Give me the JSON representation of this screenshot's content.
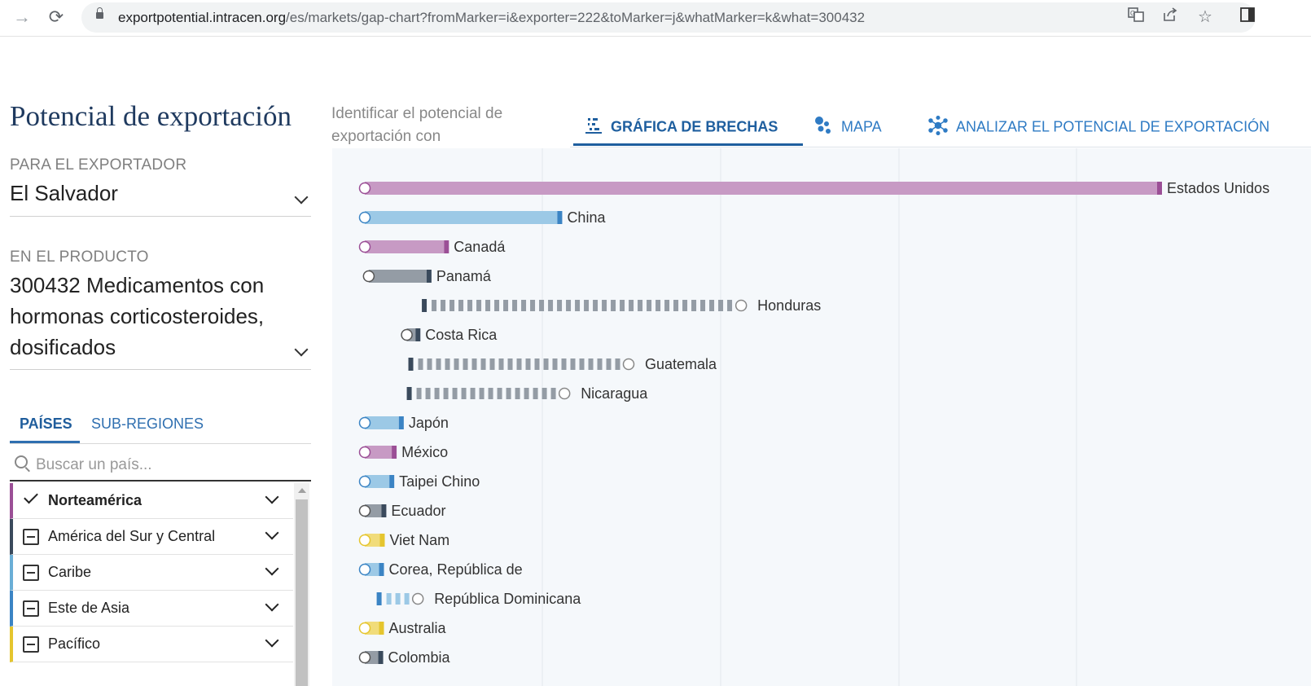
{
  "browser": {
    "url_host": "exportpotential.intracen.org",
    "url_path": "/es/markets/gap-chart?fromMarker=i&exporter=222&toMarker=j&whatMarker=k&what=300432"
  },
  "app": {
    "title": "Potencial de exportación"
  },
  "exporter": {
    "label": "PARA EL EXPORTADOR",
    "value": "El Salvador"
  },
  "product": {
    "label": "EN EL PRODUCTO",
    "lines": [
      "300432 Medicamentos con",
      "hormonas corticosteroides,",
      "dosificados"
    ]
  },
  "left_tabs": {
    "countries": "PAÍSES",
    "subregions": "SUB-REGIONES"
  },
  "search": {
    "placeholder": "Buscar un país..."
  },
  "regions": [
    {
      "label": "Norteamérica",
      "color": "#9b4f96",
      "selected": true
    },
    {
      "label": "América del Sur y Central",
      "color": "#3a4a5c",
      "selected": false
    },
    {
      "label": "Caribe",
      "color": "#6aaed6",
      "selected": false
    },
    {
      "label": "Este de Asia",
      "color": "#3b84c4",
      "selected": false
    },
    {
      "label": "Pacífico",
      "color": "#e5c52e",
      "selected": false
    }
  ],
  "identify_text": "Identificar el potencial de exportación con",
  "main_tabs": {
    "gap_chart": "GRÁFICA DE BRECHAS",
    "map": "MAPA",
    "analyze": "ANALIZAR EL POTENCIAL DE EXPORTACIÓN"
  },
  "colors": {
    "north_america": "#c79ac4",
    "north_america_dark": "#9b4f96",
    "east_asia": "#9cc9e6",
    "east_asia_dark": "#3b84c4",
    "central_south": "#949ca5",
    "central_south_dark": "#3a4a5c",
    "pacific": "#f1dc7a",
    "pacific_dark": "#e5c52e",
    "accent": "#2f7bc4"
  },
  "chart_data": {
    "type": "gap-chart",
    "rows": [
      {
        "country": "Estados Unidos",
        "potential": 0.0,
        "actual": 1.0,
        "direction": "under",
        "group": "north_america"
      },
      {
        "country": "China",
        "potential": 0.0,
        "actual": 0.243,
        "direction": "under",
        "group": "east_asia"
      },
      {
        "country": "Canadá",
        "potential": 0.0,
        "actual": 0.1,
        "direction": "under",
        "group": "north_america"
      },
      {
        "country": "Panamá",
        "potential": 0.005,
        "actual": 0.078,
        "direction": "under",
        "group": "central_south"
      },
      {
        "country": "Honduras",
        "potential": 0.475,
        "actual": 0.072,
        "direction": "over",
        "group": "central_south"
      },
      {
        "country": "Costa Rica",
        "potential": 0.053,
        "actual": 0.064,
        "direction": "under",
        "group": "central_south"
      },
      {
        "country": "Guatemala",
        "potential": 0.333,
        "actual": 0.055,
        "direction": "over",
        "group": "central_south"
      },
      {
        "country": "Nicaragua",
        "potential": 0.252,
        "actual": 0.053,
        "direction": "over",
        "group": "central_south"
      },
      {
        "country": "Japón",
        "potential": 0.0,
        "actual": 0.043,
        "direction": "under",
        "group": "east_asia"
      },
      {
        "country": "México",
        "potential": 0.0,
        "actual": 0.034,
        "direction": "under",
        "group": "north_america"
      },
      {
        "country": "Taipei Chino",
        "potential": 0.0,
        "actual": 0.031,
        "direction": "under",
        "group": "east_asia"
      },
      {
        "country": "Ecuador",
        "potential": 0.0,
        "actual": 0.021,
        "direction": "under",
        "group": "central_south"
      },
      {
        "country": "Viet Nam",
        "potential": 0.0,
        "actual": 0.019,
        "direction": "under",
        "group": "pacific"
      },
      {
        "country": "Corea, República de",
        "potential": 0.0,
        "actual": 0.018,
        "direction": "under",
        "group": "east_asia"
      },
      {
        "country": "República Dominicana",
        "potential": 0.067,
        "actual": 0.015,
        "direction": "over",
        "group": "east_asia"
      },
      {
        "country": "Australia",
        "potential": 0.0,
        "actual": 0.018,
        "direction": "under",
        "group": "pacific"
      },
      {
        "country": "Colombia",
        "potential": 0.0,
        "actual": 0.017,
        "direction": "under",
        "group": "central_south"
      }
    ],
    "grid": true
  }
}
